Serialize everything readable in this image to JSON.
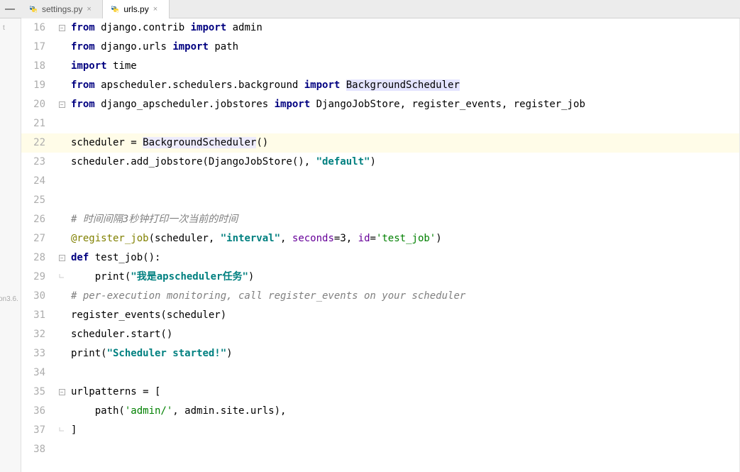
{
  "tabs": [
    {
      "name": "settings.py",
      "active": false
    },
    {
      "name": "urls.py",
      "active": true
    }
  ],
  "sidebar": {
    "partial_text_top": "t",
    "partial_text_bottom": "on3.6."
  },
  "code": {
    "lines": [
      {
        "num": 16,
        "fold": "minus",
        "tokens": [
          {
            "t": "kw",
            "v": "from "
          },
          {
            "t": "",
            "v": "django.contrib "
          },
          {
            "t": "kw",
            "v": "import "
          },
          {
            "t": "",
            "v": "admin"
          }
        ]
      },
      {
        "num": 17,
        "tokens": [
          {
            "t": "kw",
            "v": "from "
          },
          {
            "t": "",
            "v": "django.urls "
          },
          {
            "t": "kw",
            "v": "import "
          },
          {
            "t": "",
            "v": "path"
          }
        ]
      },
      {
        "num": 18,
        "tokens": [
          {
            "t": "kw",
            "v": "import "
          },
          {
            "t": "",
            "v": "time"
          }
        ]
      },
      {
        "num": 19,
        "tokens": [
          {
            "t": "kw",
            "v": "from "
          },
          {
            "t": "",
            "v": "apscheduler.schedulers.background "
          },
          {
            "t": "kw",
            "v": "import "
          },
          {
            "t": "hl-bg",
            "v": "BackgroundScheduler"
          }
        ]
      },
      {
        "num": 20,
        "fold": "minus",
        "tokens": [
          {
            "t": "kw",
            "v": "from "
          },
          {
            "t": "",
            "v": "django_apscheduler.jobstores "
          },
          {
            "t": "kw",
            "v": "import "
          },
          {
            "t": "",
            "v": "DjangoJobStore, register_events, register_job"
          }
        ]
      },
      {
        "num": 21,
        "tokens": []
      },
      {
        "num": 22,
        "highlighted": true,
        "tokens": [
          {
            "t": "",
            "v": "scheduler = "
          },
          {
            "t": "hl-name",
            "v": "BackgroundScheduler"
          },
          {
            "t": "",
            "v": "()"
          }
        ]
      },
      {
        "num": 23,
        "tokens": [
          {
            "t": "",
            "v": "scheduler.add_jobstore(DjangoJobStore(), "
          },
          {
            "t": "str",
            "v": "\"default\""
          },
          {
            "t": "",
            "v": ")"
          }
        ]
      },
      {
        "num": 24,
        "tokens": []
      },
      {
        "num": 25,
        "tokens": []
      },
      {
        "num": 26,
        "tokens": [
          {
            "t": "comment",
            "v": "# 时间间隔3秒钟打印一次当前的时间"
          }
        ]
      },
      {
        "num": 27,
        "tokens": [
          {
            "t": "decorator",
            "v": "@register_job"
          },
          {
            "t": "",
            "v": "(scheduler, "
          },
          {
            "t": "str",
            "v": "\"interval\""
          },
          {
            "t": "",
            "v": ", "
          },
          {
            "t": "param",
            "v": "seconds"
          },
          {
            "t": "",
            "v": "="
          },
          {
            "t": "",
            "v": "3"
          },
          {
            "t": "",
            "v": ", "
          },
          {
            "t": "param",
            "v": "id"
          },
          {
            "t": "",
            "v": "="
          },
          {
            "t": "str2",
            "v": "'test_job'"
          },
          {
            "t": "",
            "v": ")"
          }
        ]
      },
      {
        "num": 28,
        "fold": "minus",
        "tokens": [
          {
            "t": "kw",
            "v": "def "
          },
          {
            "t": "func",
            "v": "test_job"
          },
          {
            "t": "",
            "v": "():"
          }
        ]
      },
      {
        "num": 29,
        "fold": "end",
        "tokens": [
          {
            "t": "",
            "v": "    print("
          },
          {
            "t": "str",
            "v": "\"我是apscheduler任务\""
          },
          {
            "t": "",
            "v": ")"
          }
        ]
      },
      {
        "num": 30,
        "tokens": [
          {
            "t": "comment",
            "v": "# per-execution monitoring, call register_events on your scheduler"
          }
        ]
      },
      {
        "num": 31,
        "tokens": [
          {
            "t": "",
            "v": "register_events(scheduler)"
          }
        ]
      },
      {
        "num": 32,
        "tokens": [
          {
            "t": "",
            "v": "scheduler.start()"
          }
        ]
      },
      {
        "num": 33,
        "tokens": [
          {
            "t": "",
            "v": "print("
          },
          {
            "t": "str",
            "v": "\"Scheduler started!\""
          },
          {
            "t": "",
            "v": ")"
          }
        ]
      },
      {
        "num": 34,
        "tokens": []
      },
      {
        "num": 35,
        "fold": "minus",
        "tokens": [
          {
            "t": "",
            "v": "urlpatterns = ["
          }
        ]
      },
      {
        "num": 36,
        "tokens": [
          {
            "t": "",
            "v": "    path("
          },
          {
            "t": "str2",
            "v": "'admin/'"
          },
          {
            "t": "",
            "v": ", admin.site.urls),"
          }
        ]
      },
      {
        "num": 37,
        "fold": "end",
        "tokens": [
          {
            "t": "",
            "v": "]"
          }
        ]
      },
      {
        "num": 38,
        "tokens": []
      }
    ]
  }
}
